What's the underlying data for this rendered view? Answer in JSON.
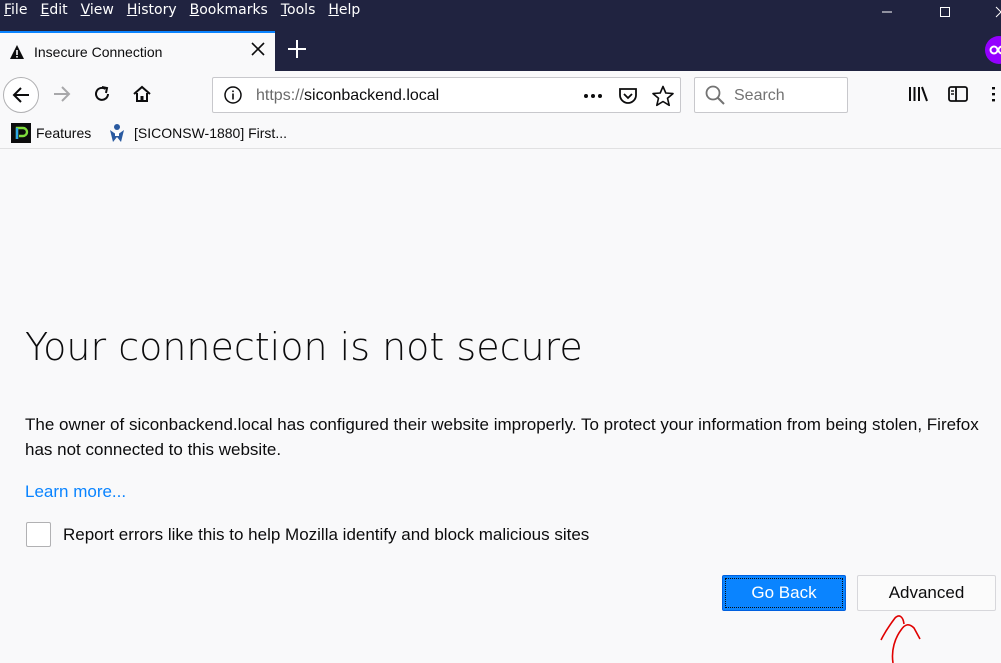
{
  "menu": [
    "File",
    "Edit",
    "View",
    "History",
    "Bookmarks",
    "Tools",
    "Help"
  ],
  "tab": {
    "title": "Insecure Connection"
  },
  "urlbar": {
    "scheme": "https://",
    "host": "siconbackend.local"
  },
  "search": {
    "placeholder": "Search"
  },
  "bookmarks": [
    {
      "label": "Features"
    },
    {
      "label": "[SICONSW-1880] First..."
    }
  ],
  "error": {
    "title": "Your connection is not secure",
    "description": "The owner of siconbackend.local has configured their website improperly. To protect your information from being stolen, Firefox has not connected to this website.",
    "learn_more": "Learn more...",
    "report_label": "Report errors like this to help Mozilla identify and block malicious sites",
    "go_back": "Go Back",
    "advanced": "Advanced"
  },
  "colors": {
    "titlebar": "#202340",
    "accent": "#0a84ff",
    "annotation": "#e00000"
  },
  "icons": [
    "warning-icon",
    "close-icon",
    "plus-icon",
    "back-icon",
    "forward-icon",
    "reload-icon",
    "home-icon",
    "info-icon",
    "more-icon",
    "pocket-icon",
    "star-icon",
    "search-icon",
    "library-icon",
    "sidebar-icon",
    "menu-icon"
  ]
}
